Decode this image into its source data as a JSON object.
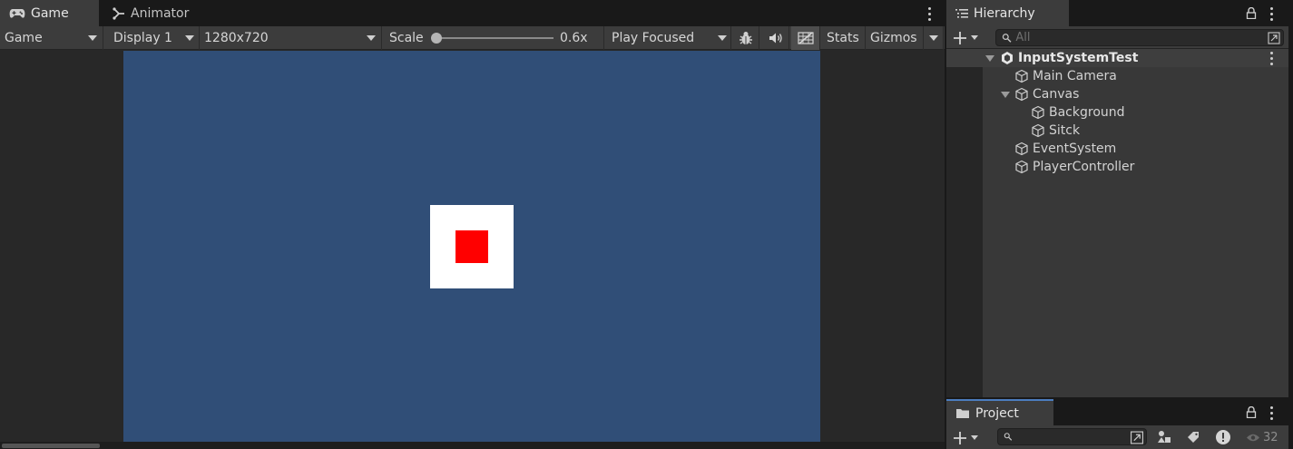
{
  "game_panel": {
    "tabs": [
      {
        "label": "Game",
        "icon": "gamepad-icon",
        "active": true
      },
      {
        "label": "Animator",
        "icon": "animator-icon",
        "active": false
      }
    ],
    "toolbar": {
      "view_mode": "Game",
      "display": "Display 1",
      "resolution": "1280x720",
      "scale_label": "Scale",
      "scale_value": "0.6x",
      "scale_level": 0.0,
      "play_mode": "Play Focused",
      "stats": "Stats",
      "gizmos": "Gizmos"
    },
    "colors": {
      "canvas_background": "#304e77",
      "background_square": "#ffffff",
      "stick_square": "#ff0000"
    }
  },
  "hierarchy_panel": {
    "tab_label": "Hierarchy",
    "search_placeholder": "All",
    "scene_name": "InputSystemTest",
    "items": [
      {
        "label": "Main Camera",
        "depth": 1
      },
      {
        "label": "Canvas",
        "depth": 1,
        "expanded": true
      },
      {
        "label": "Background",
        "depth": 2
      },
      {
        "label": "Sitck",
        "depth": 2
      },
      {
        "label": "EventSystem",
        "depth": 1
      },
      {
        "label": "PlayerController",
        "depth": 1
      }
    ]
  },
  "project_panel": {
    "tab_label": "Project",
    "hidden_count": "32"
  }
}
